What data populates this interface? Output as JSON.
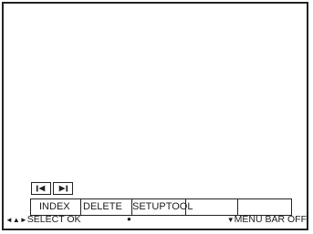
{
  "navigation": {
    "prev_icon": "skip-back-icon",
    "next_icon": "skip-forward-icon"
  },
  "menu_bar": {
    "items": [
      {
        "label": "INDEX"
      },
      {
        "label": "DELETE"
      },
      {
        "label": "SETUP"
      },
      {
        "label": "TOOL"
      },
      {
        "label": ""
      }
    ]
  },
  "status_bar": {
    "select_arrows": "◄▲►",
    "select_label": "SELECT",
    "ok_label": "OK",
    "ok_marker": "●",
    "menu_arrow": "▼",
    "menu_label": "MENU BAR OFF"
  }
}
